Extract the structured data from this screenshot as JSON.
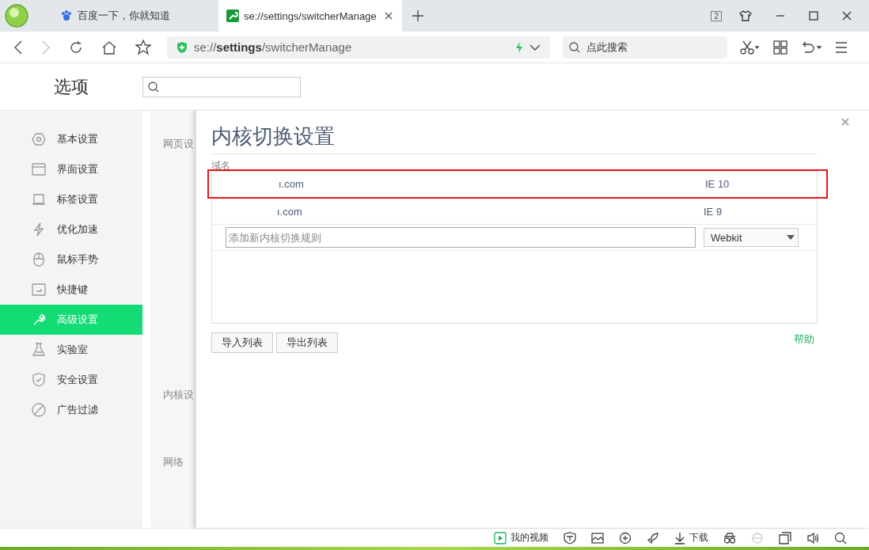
{
  "browser": {
    "tabs": [
      {
        "label": "百度一下，你就知道",
        "selected": false,
        "kind": "paw"
      },
      {
        "label": "se://settings/switcherManage",
        "selected": true,
        "kind": "wrench"
      }
    ],
    "tab_count": "2",
    "address": "se://**settings**/switcherManage",
    "search": {
      "placeholder": "点此搜索"
    }
  },
  "page": {
    "title": "选项",
    "sidebar": {
      "items": [
        {
          "label": "基本设置",
          "selected": false
        },
        {
          "label": "界面设置",
          "selected": false
        },
        {
          "label": "标签设置",
          "selected": false
        },
        {
          "label": "优化加速",
          "selected": false
        },
        {
          "label": "鼠标手势",
          "selected": false
        },
        {
          "label": "快捷键",
          "selected": false
        },
        {
          "label": "高级设置",
          "selected": true
        },
        {
          "label": "实验室",
          "selected": false
        },
        {
          "label": "安全设置",
          "selected": false
        },
        {
          "label": "广告过滤",
          "selected": false
        }
      ]
    },
    "sections": [
      "网页设",
      "内核设",
      "网络"
    ]
  },
  "dialog": {
    "title": "内核切换设置",
    "column_label": "域名",
    "rules": [
      {
        "domain": "ı.com",
        "engine": "IE 10",
        "highlighted": true
      },
      {
        "domain": "ı.com",
        "engine": "IE 9",
        "highlighted": false
      }
    ],
    "new_rule": {
      "placeholder": "添加新内核切换规则",
      "engine": "Webkit"
    },
    "buttons": [
      "导入列表",
      "导出列表"
    ],
    "help": "帮助"
  },
  "status_bar": {
    "video": "我的视频",
    "download": "下载"
  }
}
